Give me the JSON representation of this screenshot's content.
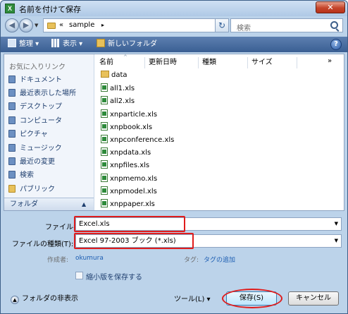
{
  "window": {
    "title": "名前を付けて保存",
    "app_icon": "X",
    "close_label": "✕"
  },
  "address": {
    "prefix": "«",
    "path": "sample",
    "arrow": "▸",
    "dropdown": "▾"
  },
  "search": {
    "placeholder": "検索"
  },
  "toolbar": {
    "organize": "整理",
    "views": "表示",
    "new_folder": "新しいフォルダ",
    "help": "?"
  },
  "sidebar": {
    "favorites_header": "お気に入りリンク",
    "items": [
      {
        "label": "ドキュメント",
        "icon": "documents-icon"
      },
      {
        "label": "最近表示した場所",
        "icon": "recent-places-icon"
      },
      {
        "label": "デスクトップ",
        "icon": "desktop-icon"
      },
      {
        "label": "コンピュータ",
        "icon": "computer-icon"
      },
      {
        "label": "ピクチャ",
        "icon": "pictures-icon"
      },
      {
        "label": "ミュージック",
        "icon": "music-icon"
      },
      {
        "label": "最近の変更",
        "icon": "recently-changed-icon"
      },
      {
        "label": "検索",
        "icon": "searches-icon"
      },
      {
        "label": "パブリック",
        "icon": "public-folder-icon"
      }
    ],
    "folders_label": "フォルダ",
    "folders_chevron": "▲"
  },
  "columns": {
    "name": "名前",
    "modified": "更新日時",
    "type": "種類",
    "size": "サイズ",
    "more": "»",
    "sort_arrow": "^"
  },
  "files": [
    {
      "name": "data",
      "kind": "folder"
    },
    {
      "name": "all1.xls",
      "kind": "xls"
    },
    {
      "name": "all2.xls",
      "kind": "xls"
    },
    {
      "name": "xnparticle.xls",
      "kind": "xls"
    },
    {
      "name": "xnpbook.xls",
      "kind": "xls"
    },
    {
      "name": "xnpconference.xls",
      "kind": "xls"
    },
    {
      "name": "xnpdata.xls",
      "kind": "xls"
    },
    {
      "name": "xnpfiles.xls",
      "kind": "xls"
    },
    {
      "name": "xnpmemo.xls",
      "kind": "xls"
    },
    {
      "name": "xnpmodel.xls",
      "kind": "xls"
    },
    {
      "name": "xnppaper.xls",
      "kind": "xls"
    }
  ],
  "form": {
    "filename_label": "ファイル名(N):",
    "filename_value": "Excel.xls",
    "filetype_label": "ファイルの種類(T):",
    "filetype_value": "Excel 97-2003 ブック (*.xls)",
    "author_label": "作成者:",
    "author_value": "okumura",
    "tags_label": "タグ:",
    "tags_value": "タグの追加",
    "thumbnail_label": "縮小版を保存する"
  },
  "footer": {
    "hide_folders": "フォルダの非表示",
    "tools": "ツール(L)",
    "save": "保存(S)",
    "cancel": "キャンセル"
  },
  "colors": {
    "highlight": "#e01c1c",
    "toolbar": "#3a5f93",
    "link": "#1e5fb3"
  }
}
